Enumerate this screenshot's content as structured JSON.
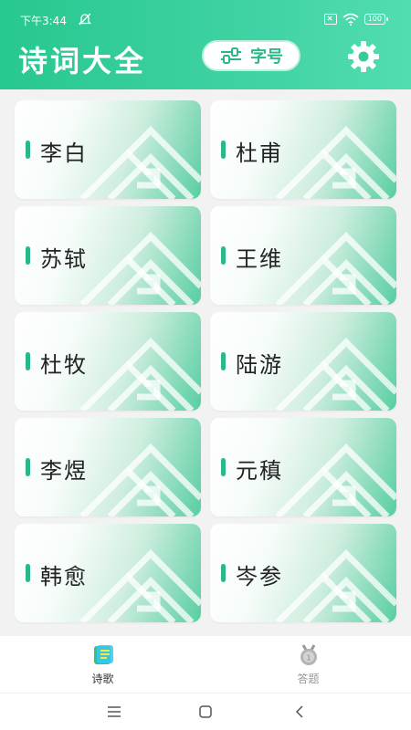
{
  "status": {
    "time": "下午3:44",
    "battery": "100"
  },
  "header": {
    "title": "诗词大全",
    "font_size_label": "字号"
  },
  "poets": [
    {
      "name": "李白"
    },
    {
      "name": "杜甫"
    },
    {
      "name": "苏轼"
    },
    {
      "name": "王维"
    },
    {
      "name": "杜牧"
    },
    {
      "name": "陆游"
    },
    {
      "name": "李煜"
    },
    {
      "name": "元稹"
    },
    {
      "name": "韩愈"
    },
    {
      "name": "岑参"
    }
  ],
  "tabs": [
    {
      "label": "诗歌",
      "active": true,
      "icon": "poem-book-icon"
    },
    {
      "label": "答题",
      "active": false,
      "icon": "quiz-medal-icon"
    }
  ],
  "colors": {
    "brand": "#2ab886",
    "header_gradient_end": "#52dcb2"
  }
}
